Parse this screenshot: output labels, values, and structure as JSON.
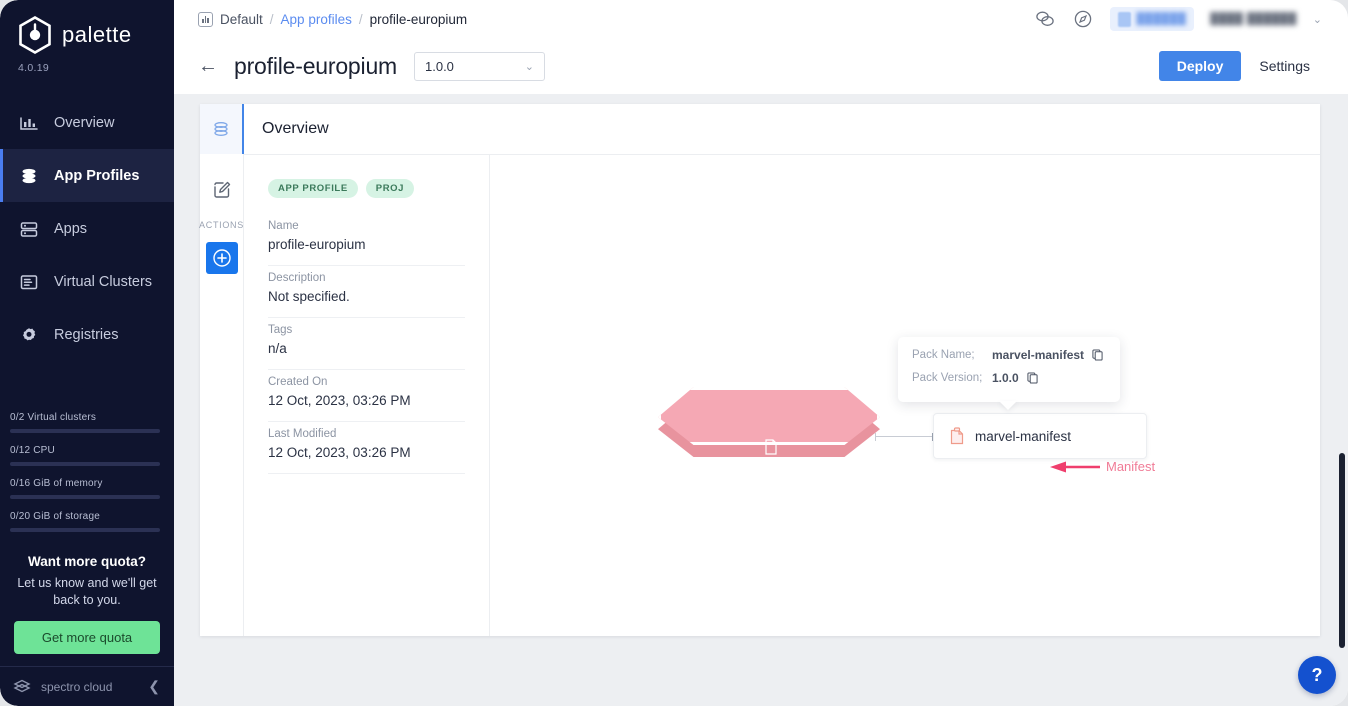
{
  "sidebar": {
    "brand": "palette",
    "logo_icon": "palette-hex-logo",
    "version": "4.0.19",
    "items": [
      {
        "label": "Overview",
        "icon": "chart-overview-icon",
        "active": false
      },
      {
        "label": "App Profiles",
        "icon": "layers-stack-icon",
        "active": true
      },
      {
        "label": "Apps",
        "icon": "server-apps-icon",
        "active": false
      },
      {
        "label": "Virtual Clusters",
        "icon": "clusters-list-icon",
        "active": false
      },
      {
        "label": "Registries",
        "icon": "gear-icon",
        "active": false
      }
    ],
    "quota": [
      {
        "label": "0/2 Virtual clusters",
        "percent": 0
      },
      {
        "label": "0/12 CPU",
        "percent": 0
      },
      {
        "label": "0/16 GiB of memory",
        "percent": 0
      },
      {
        "label": "0/20 GiB of storage",
        "percent": 0
      }
    ],
    "promo": {
      "title": "Want more quota?",
      "subtitle": "Let us know and we'll get back to you.",
      "button": "Get more quota",
      "button_color": "#6ee397"
    },
    "footer": {
      "name": "spectro cloud",
      "logo_icon": "spectro-cloud-logo",
      "collapse_icon": "chevron-left-icon"
    }
  },
  "header": {
    "breadcrumb": {
      "icon": "project-bars-icon",
      "project": "Default",
      "sep": "/",
      "link": "App profiles",
      "current": "profile-europium"
    },
    "actions": {
      "chat_icon": "chat-bubbles-icon",
      "compass_icon": "compass-icon",
      "tenant_pill": "██████",
      "user_name": "████ ██████",
      "chevron": "⌄"
    }
  },
  "titlebar": {
    "back_icon": "arrow-left-icon",
    "title": "profile-europium",
    "version_value": "1.0.0",
    "version_chevron": "⌄",
    "deploy_label": "Deploy",
    "settings_label": "Settings",
    "deploy_color": "#4285e8"
  },
  "rail": {
    "tab_icon": "layers-stack-icon",
    "edit_icon": "edit-pencil-icon",
    "actions_label": "ACTIONS",
    "add_icon": "plus-circle-icon"
  },
  "overview": {
    "heading": "Overview",
    "badges": [
      {
        "label": "APP PROFILE"
      },
      {
        "label": "PROJ"
      }
    ],
    "fields": [
      {
        "label": "Name",
        "value": "profile-europium"
      },
      {
        "label": "Description",
        "value": "Not specified."
      },
      {
        "label": "Tags",
        "value": "n/a"
      },
      {
        "label": "Created On",
        "value": "12 Oct, 2023, 03:26 PM"
      },
      {
        "label": "Last Modified",
        "value": "12 Oct, 2023, 03:26 PM"
      }
    ]
  },
  "graph": {
    "layer_color": "#f5a8b4",
    "layer_side_color": "#e8939e",
    "layer_doc_icon": "manifest-doc-icon",
    "node": {
      "icon": "manifest-file-icon",
      "name": "marvel-manifest"
    },
    "popover": {
      "pack_name_key": "Pack Name;",
      "pack_name_value": "marvel-manifest",
      "pack_version_key": "Pack Version;",
      "pack_version_value": "1.0.0",
      "copy_icon": "copy-icon"
    },
    "annotation": {
      "arrow_icon": "left-arrow-annotation-icon",
      "text": "Manifest",
      "color": "#f07b96"
    }
  },
  "help": {
    "label": "?"
  }
}
